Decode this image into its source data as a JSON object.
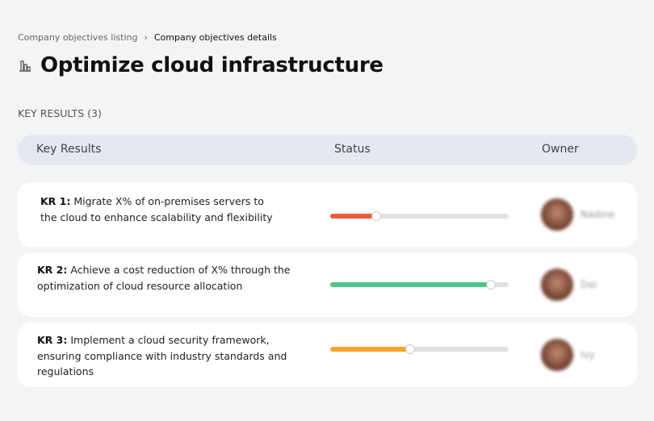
{
  "breadcrumb": {
    "parent": "Company objectives listing",
    "current": "Company objectives details"
  },
  "title": "Optimize cloud infrastructure",
  "section_label": "KEY RESULTS (3)",
  "columns": {
    "key_results": "Key Results",
    "status": "Status",
    "owner": "Owner"
  },
  "rows": [
    {
      "label": "KR 1:",
      "text": "Migrate X% of on-premises servers to the cloud to enhance scalability and flexibility",
      "progress": 26,
      "color": "#f05a38",
      "owner": "Nadine"
    },
    {
      "label": "KR 2:",
      "text": "Achieve a cost reduction of X% through the optimization of cloud resource allocation",
      "progress": 90,
      "color": "#4fc38a",
      "owner": "Dai"
    },
    {
      "label": "KR 3:",
      "text": "Implement a cloud security framework, ensuring compliance with industry standards and regulations",
      "progress": 45,
      "color": "#f7a42b",
      "owner": "Ivy"
    }
  ]
}
